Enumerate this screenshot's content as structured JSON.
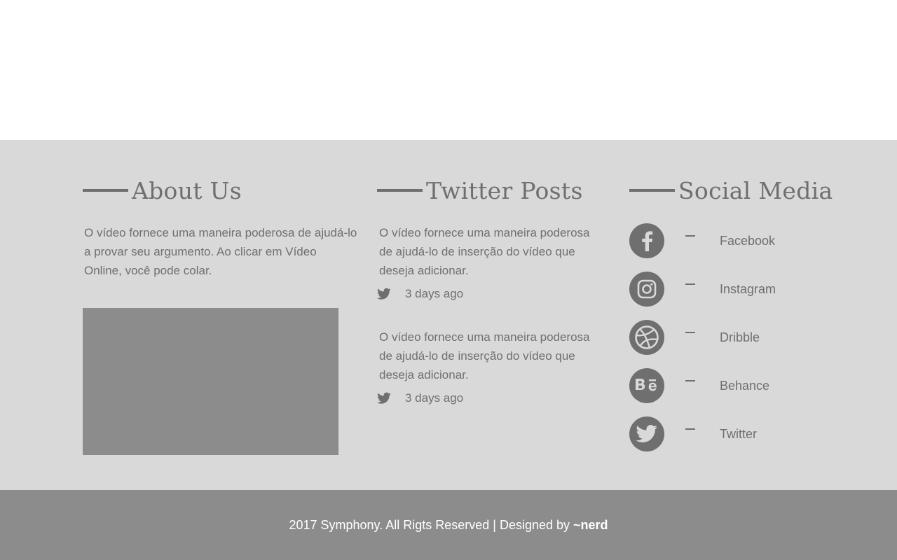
{
  "about": {
    "title": "About Us",
    "text": "O vídeo fornece uma maneira poderosa de ajudá-lo a provar seu argumento. Ao clicar em Vídeo Online, você pode colar."
  },
  "twitter": {
    "title": "Twitter Posts",
    "posts": [
      {
        "text": "O vídeo fornece uma maneira poderosa de ajudá-lo de inserção do vídeo que deseja adicionar.",
        "time": "3 days ago",
        "icon": "twitter-bird-icon"
      },
      {
        "text": "O vídeo fornece uma maneira poderosa de ajudá-lo de inserção do vídeo que deseja adicionar.",
        "time": "3 days ago",
        "icon": "twitter-bird-icon"
      }
    ]
  },
  "social": {
    "title": "Social Media",
    "items": [
      {
        "label": "Facebook",
        "icon": "facebook-icon"
      },
      {
        "label": "Instagram",
        "icon": "instagram-icon"
      },
      {
        "label": "Dribble",
        "icon": "dribbble-icon"
      },
      {
        "label": "Behance",
        "icon": "behance-icon"
      },
      {
        "label": "Twitter",
        "icon": "twitter-icon"
      }
    ]
  },
  "footer": {
    "copyright": "2017 Symphony. All Rigts Reserved | Designed by ",
    "brand": "~nerd"
  },
  "colors": {
    "footer_bg": "#d9d9d9",
    "bottom_bar_bg": "#8c8c8c",
    "text": "#6f6f6f",
    "icon": "#6f6f6f"
  }
}
